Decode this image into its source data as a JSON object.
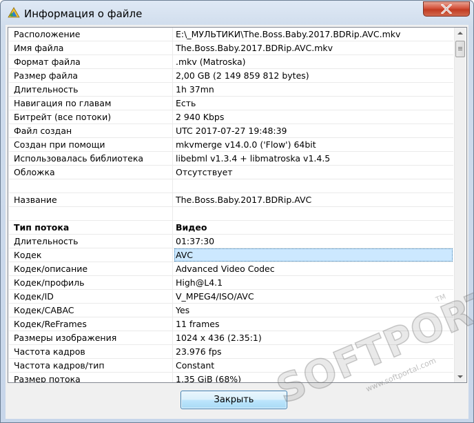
{
  "window": {
    "title": "Информация о файле",
    "close_glyph": "X"
  },
  "table": {
    "rows": [
      {
        "key": "Расположение",
        "value": "E:\\_МУЛЬТИКИ\\The.Boss.Baby.2017.BDRip.AVC.mkv"
      },
      {
        "key": "Имя файла",
        "value": "The.Boss.Baby.2017.BDRip.AVC.mkv"
      },
      {
        "key": "Формат файла",
        "value": ".mkv (Matroska)"
      },
      {
        "key": "Размер файла",
        "value": "2,00 GB (2 149 859 812 bytes)"
      },
      {
        "key": "Длительность",
        "value": "1h 37mn"
      },
      {
        "key": "Навигация по главам",
        "value": "Есть"
      },
      {
        "key": "Битрейт (все потоки)",
        "value": "2 940 Kbps"
      },
      {
        "key": "Файл создан",
        "value": "UTC 2017-07-27 19:48:39"
      },
      {
        "key": "Создан при помощи",
        "value": "mkvmerge v14.0.0 ('Flow') 64bit"
      },
      {
        "key": "Использовалась библиотека",
        "value": "libebml v1.3.4 + libmatroska v1.4.5"
      },
      {
        "key": "Обложка",
        "value": "Отсутствует"
      },
      {
        "key": "",
        "value": ""
      },
      {
        "key": "Название",
        "value": "The.Boss.Baby.2017.BDRip.AVC"
      },
      {
        "key": "",
        "value": ""
      },
      {
        "key": "Тип потока",
        "value": "Видео"
      },
      {
        "key": "Длительность",
        "value": "01:37:30"
      },
      {
        "key": "Кодек",
        "value": "AVC"
      },
      {
        "key": "Кодек/описание",
        "value": "Advanced Video Codec"
      },
      {
        "key": "Кодек/профиль",
        "value": "High@L4.1"
      },
      {
        "key": "Кодек/ID",
        "value": "V_MPEG4/ISO/AVC"
      },
      {
        "key": "Кодек/CABAC",
        "value": "Yes"
      },
      {
        "key": "Кодек/ReFrames",
        "value": "11 frames"
      },
      {
        "key": "Размеры изображения",
        "value": "1024 x 436 (2.35:1)"
      },
      {
        "key": "Частота кадров",
        "value": "23.976 fps"
      },
      {
        "key": "Частота кадров/тип",
        "value": "Constant"
      },
      {
        "key": "Размер потока",
        "value": "1,35 GiB (68%)"
      }
    ],
    "bold_row_index": 14,
    "selected_row_index": 16
  },
  "buttons": {
    "close_label": "Закрыть"
  },
  "watermark": {
    "brand": "SOFTPORTAL",
    "url": "www.softportal.com",
    "tm": "TM"
  },
  "icons": {
    "app": "mediainfo-triangle-icon",
    "close": "close-icon",
    "scroll_up": "arrow-up-icon",
    "scroll_down": "arrow-down-icon"
  },
  "colors": {
    "selection": "#cce8ff",
    "close_red": "#c23b22",
    "button_border": "#3c7fb1"
  }
}
